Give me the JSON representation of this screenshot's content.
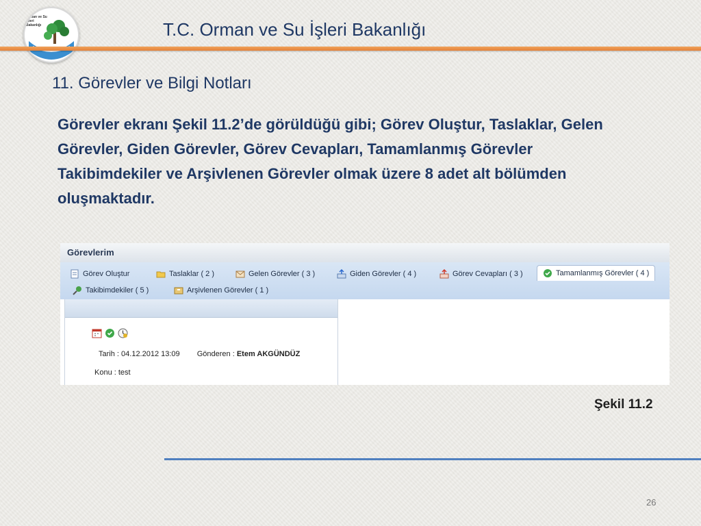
{
  "logo": {
    "text_line1": "T.C.",
    "text_line2": "Orman ve Su İşleri",
    "text_line3": "Bakanlığı"
  },
  "header": {
    "title": "T.C. Orman ve Su İşleri Bakanlığı"
  },
  "section": {
    "title": "11. Görevler ve Bilgi Notları"
  },
  "body": {
    "paragraph": "Görevler ekranı Şekil 11.2’de görüldüğü gibi; Görev Oluştur, Taslaklar, Gelen Görevler, Giden Görevler, Görev Cevapları, Tamamlanmış Görevler Takibimdekiler ve Arşivlenen Görevler olmak üzere 8 adet alt bölümden oluşmaktadır."
  },
  "screenshot": {
    "title": "Görevlerim",
    "tabs": [
      {
        "label": "Görev Oluştur",
        "icon": "create-task-icon"
      },
      {
        "label": "Taslaklar ( 2 )",
        "icon": "drafts-folder-icon"
      },
      {
        "label": "Gelen Görevler ( 3 )",
        "icon": "inbox-icon"
      },
      {
        "label": "Giden Görevler ( 4 )",
        "icon": "outbox-icon"
      },
      {
        "label": "Görev Cevapları ( 3 )",
        "icon": "reply-icon"
      },
      {
        "label": "Tamamlanmış Görevler ( 4 )",
        "icon": "check-circle-icon"
      },
      {
        "label": "Takibimdekiler ( 5 )",
        "icon": "tracking-icon"
      },
      {
        "label": "Arşivlenen Görevler ( 1 )",
        "icon": "archive-icon"
      }
    ],
    "active_tab": "Tamamlanmış Görevler ( 4 )",
    "item": {
      "date_label": "Tarih :",
      "date_value": "04.12.2012 13:09",
      "sender_label": "Gönderen :",
      "sender_value": "Etem AKGÜNDÜZ",
      "subject": "Konu : test"
    }
  },
  "caption": "Şekil 11.2",
  "page_number": "26",
  "colors": {
    "title": "#1f3864",
    "header_rule": "#e4823a",
    "bottom_rule": "#4f7fbf",
    "tab_bar": "#c5d8ef"
  }
}
